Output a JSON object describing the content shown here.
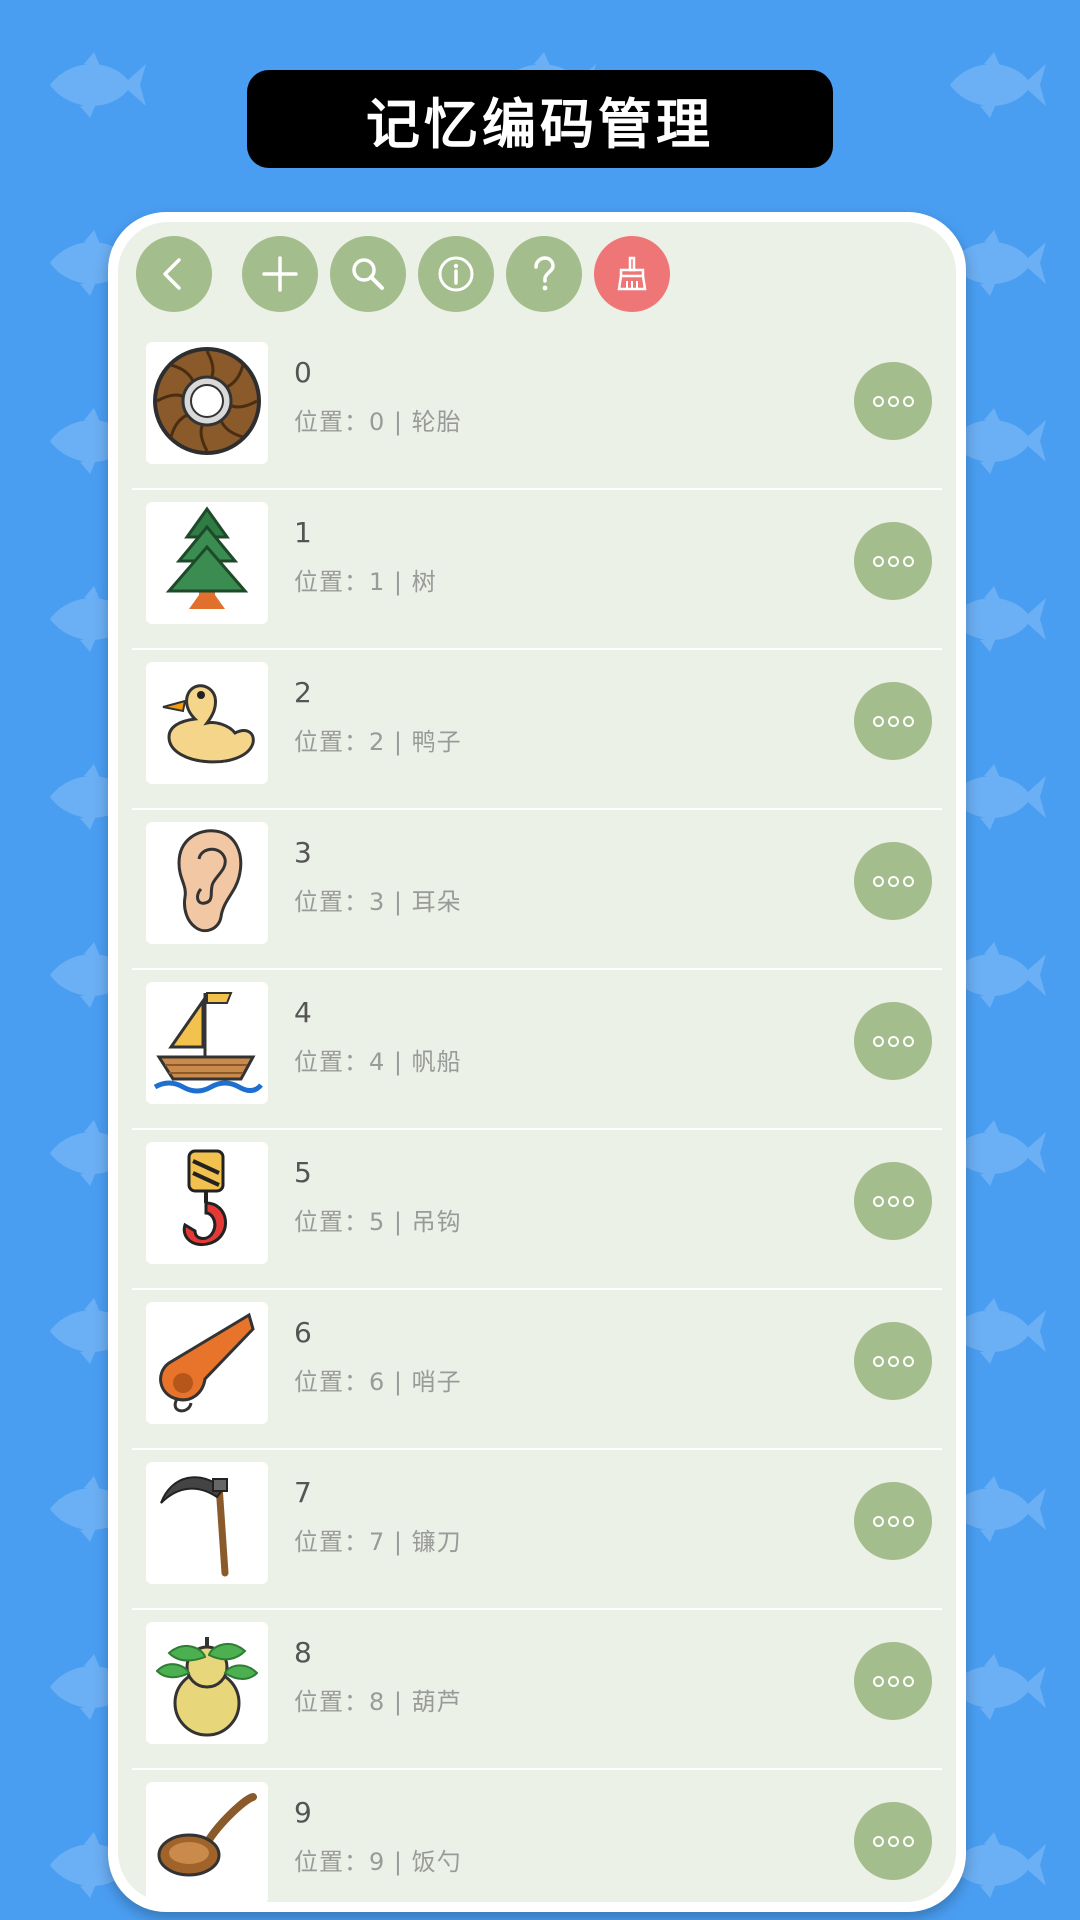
{
  "header": {
    "title": "记忆编码管理"
  },
  "toolbar": {
    "buttons": [
      {
        "icon": "back-icon"
      },
      {
        "icon": "plus-icon"
      },
      {
        "icon": "search-icon"
      },
      {
        "icon": "info-icon"
      },
      {
        "icon": "help-icon"
      },
      {
        "icon": "broom-icon"
      }
    ],
    "colors": {
      "default": "#a3be8c",
      "danger": "#ef7676"
    }
  },
  "list": {
    "items": [
      {
        "title": "0",
        "subtitle": "位置：0 | 轮胎",
        "icon": "tire-icon"
      },
      {
        "title": "1",
        "subtitle": "位置：1 | 树",
        "icon": "tree-icon"
      },
      {
        "title": "2",
        "subtitle": "位置：2 | 鸭子",
        "icon": "duck-icon"
      },
      {
        "title": "3",
        "subtitle": "位置：3 | 耳朵",
        "icon": "ear-icon"
      },
      {
        "title": "4",
        "subtitle": "位置：4 | 帆船",
        "icon": "sailboat-icon"
      },
      {
        "title": "5",
        "subtitle": "位置：5 | 吊钩",
        "icon": "hook-icon"
      },
      {
        "title": "6",
        "subtitle": "位置：6 | 哨子",
        "icon": "whistle-icon"
      },
      {
        "title": "7",
        "subtitle": "位置：7 | 镰刀",
        "icon": "sickle-icon"
      },
      {
        "title": "8",
        "subtitle": "位置：8 | 葫芦",
        "icon": "gourd-icon"
      },
      {
        "title": "9",
        "subtitle": "位置：9 | 饭勺",
        "icon": "ladle-icon"
      }
    ]
  }
}
